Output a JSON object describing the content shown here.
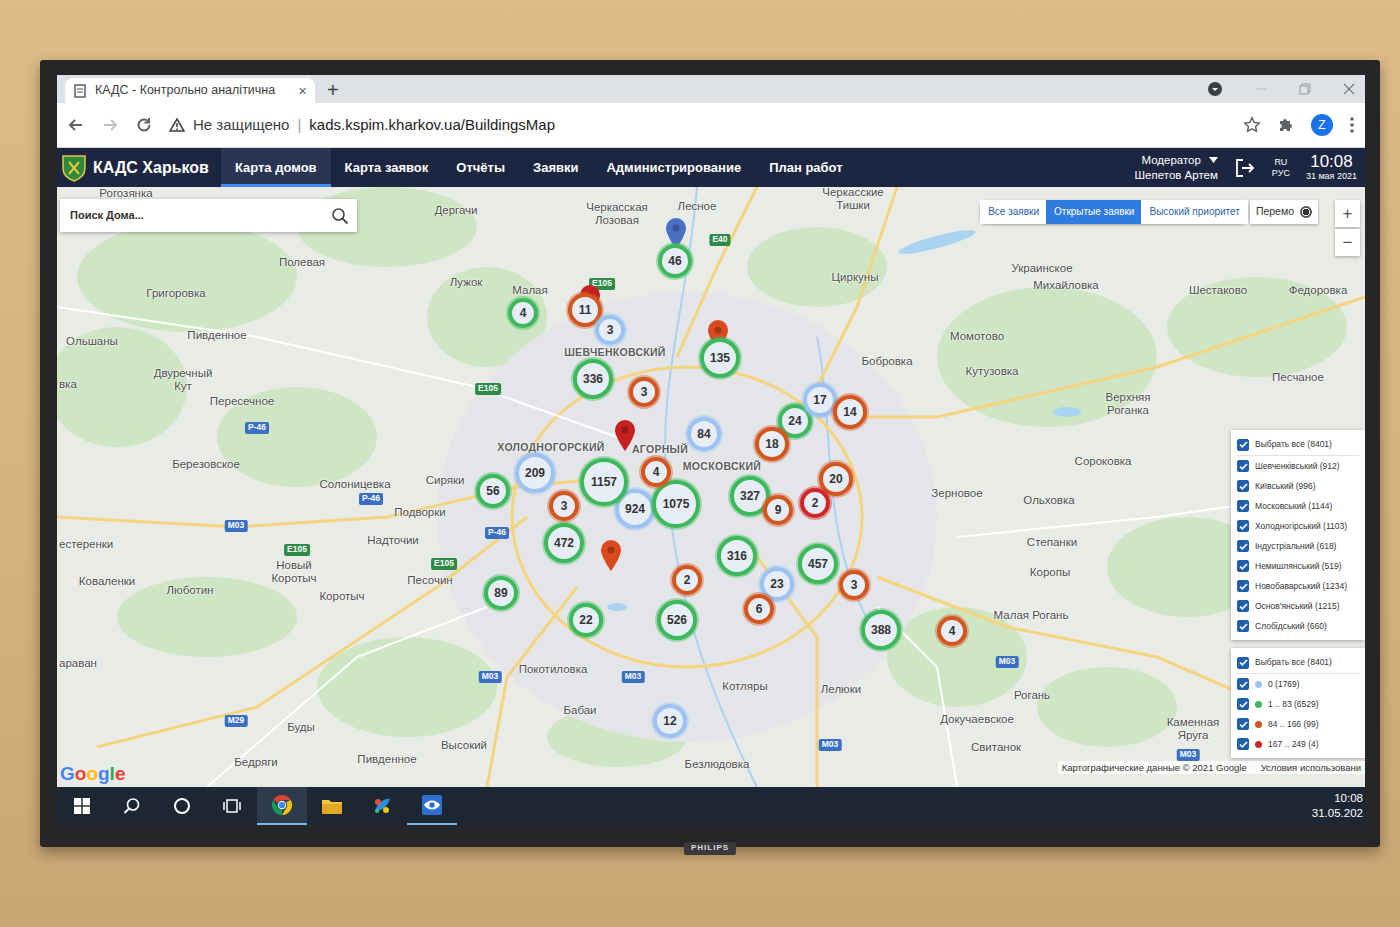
{
  "tv": {
    "brand": "PHILIPS"
  },
  "browser": {
    "tab": {
      "title": "КАДС - Контрольно аналітична",
      "close": "×"
    },
    "new_tab": "+",
    "security": "Не защищено",
    "separator": "|",
    "url": "kads.kspim.kharkov.ua/BuildingsMap",
    "avatar": "Z"
  },
  "app": {
    "title": "КАДС Харьков",
    "nav": [
      {
        "label": "Карта домов",
        "selected": true
      },
      {
        "label": "Карта заявок",
        "selected": false
      },
      {
        "label": "Отчёты",
        "selected": false
      },
      {
        "label": "Заявки",
        "selected": false
      },
      {
        "label": "Администрирование",
        "selected": false
      },
      {
        "label": "План работ",
        "selected": false
      }
    ],
    "user": {
      "role": "Модератор",
      "name": "Шепетов Артем"
    },
    "language": {
      "code": "RU",
      "label": "РУС"
    },
    "clock": {
      "time": "10:08",
      "date": "31 мая 2021"
    }
  },
  "map": {
    "search": {
      "placeholder": "Поиск Дома..."
    },
    "filters": [
      {
        "label": "Все заявки",
        "selected": false
      },
      {
        "label": "Открытые заявки",
        "selected": true
      },
      {
        "label": "Высокий приоритет",
        "selected": false
      }
    ],
    "layer_toggle": {
      "label": "Перемо",
      "checked": true
    },
    "zoom": {
      "in": "+",
      "out": "−"
    },
    "places": [
      {
        "text": "Рогозянка",
        "kind": "town"
      },
      {
        "text": "Дергачи",
        "kind": "town"
      },
      {
        "text": "Черкасская Лозовая",
        "kind": "stacked"
      },
      {
        "text": "Лесное",
        "kind": "town"
      },
      {
        "text": "Черкасские Тишки",
        "kind": "stacked"
      },
      {
        "text": "Полевая",
        "kind": "town"
      },
      {
        "text": "Григоровка",
        "kind": "town"
      },
      {
        "text": "Лужок",
        "kind": "town"
      },
      {
        "text": "Малая",
        "kind": "town"
      },
      {
        "text": "Пивденное",
        "kind": "town"
      },
      {
        "text": "Ольшаны",
        "kind": "town"
      },
      {
        "text": "Двуречный Кут",
        "kind": "stacked"
      },
      {
        "text": "Пересечное",
        "kind": "town"
      },
      {
        "text": "Циркуны",
        "kind": "town"
      },
      {
        "text": "Украинское",
        "kind": "town"
      },
      {
        "text": "Михайловка",
        "kind": "town"
      },
      {
        "text": "Шестаково",
        "kind": "town"
      },
      {
        "text": "Федоровка",
        "kind": "town"
      },
      {
        "text": "Момотово",
        "kind": "town"
      },
      {
        "text": "Бобровка",
        "kind": "town"
      },
      {
        "text": "Кутузовка",
        "kind": "town"
      },
      {
        "text": "Песчаное",
        "kind": "town"
      },
      {
        "text": "Верхняя Роганка",
        "kind": "stacked"
      },
      {
        "text": "Сороковка",
        "kind": "town"
      },
      {
        "text": "Березовское",
        "kind": "town"
      },
      {
        "text": "Солоницевка",
        "kind": "town"
      },
      {
        "text": "Сиряки",
        "kind": "town"
      },
      {
        "text": "Подворки",
        "kind": "town"
      },
      {
        "text": "Надточии",
        "kind": "town"
      },
      {
        "text": "Зерновое",
        "kind": "town"
      },
      {
        "text": "Ольховка",
        "kind": "town"
      },
      {
        "text": "Степанки",
        "kind": "town"
      },
      {
        "text": "Коропы",
        "kind": "town"
      },
      {
        "text": "Малая Рогань",
        "kind": "town"
      },
      {
        "text": "Рогань",
        "kind": "town"
      },
      {
        "text": "Коваленки",
        "kind": "town"
      },
      {
        "text": "Люботин",
        "kind": "town"
      },
      {
        "text": "Новый Коротыч",
        "kind": "stacked"
      },
      {
        "text": "Коротыч",
        "kind": "town"
      },
      {
        "text": "Песочин",
        "kind": "town"
      },
      {
        "text": "Покотиловка",
        "kind": "town"
      },
      {
        "text": "Бабаи",
        "kind": "town"
      },
      {
        "text": "Котляры",
        "kind": "town"
      },
      {
        "text": "Лелюки",
        "kind": "town"
      },
      {
        "text": "Высокий",
        "kind": "town"
      },
      {
        "text": "Буды",
        "kind": "town"
      },
      {
        "text": "Бедряги",
        "kind": "town"
      },
      {
        "text": "Пивденное",
        "kind": "town"
      },
      {
        "text": "Безлюдовка",
        "kind": "town"
      },
      {
        "text": "Докучаевское",
        "kind": "town"
      },
      {
        "text": "Свитанок",
        "kind": "town"
      },
      {
        "text": "Каменная Яруга",
        "kind": "stacked"
      },
      {
        "text": "вка",
        "kind": "edge"
      },
      {
        "text": "естеренки",
        "kind": "edge"
      },
      {
        "text": "араван",
        "kind": "edge"
      },
      {
        "text": "ШЕВЧЕНКОВСКИЙ",
        "kind": "district"
      },
      {
        "text": "ХОЛОДНОГОРСКИЙ",
        "kind": "district"
      },
      {
        "text": "МОСКОВСКИЙ",
        "kind": "district"
      },
      {
        "text": "АГОРНЫЙ",
        "kind": "district"
      }
    ],
    "roads": [
      {
        "label": "E40",
        "color": "#2e8b46"
      },
      {
        "label": "E105",
        "color": "#2e8b46"
      },
      {
        "label": "E105",
        "color": "#2e8b46"
      },
      {
        "label": "P-46",
        "color": "#3a6fc4"
      },
      {
        "label": "P-46",
        "color": "#3a6fc4"
      },
      {
        "label": "P-46",
        "color": "#3a6fc4"
      },
      {
        "label": "M03",
        "color": "#3a6fc4"
      },
      {
        "label": "E105",
        "color": "#2e8b46"
      },
      {
        "label": "E105",
        "color": "#2e8b46"
      },
      {
        "label": "M03",
        "color": "#3a6fc4"
      },
      {
        "label": "M03",
        "color": "#3a6fc4"
      },
      {
        "label": "M29",
        "color": "#3a6fc4"
      },
      {
        "label": "M03",
        "color": "#3a6fc4"
      },
      {
        "label": "M03",
        "color": "#3a6fc4"
      },
      {
        "label": "M03",
        "color": "#3a6fc4"
      }
    ],
    "pins": [
      {
        "color": "#4a70c4"
      },
      {
        "color": "#c8201f"
      },
      {
        "color": "#d9491d"
      },
      {
        "color": "#c8201f"
      },
      {
        "color": "#d9491d"
      }
    ],
    "clusters": [
      {
        "count": "46",
        "color": "#3cb95a"
      },
      {
        "count": "4",
        "color": "#3cb95a"
      },
      {
        "count": "11",
        "color": "#d4561f"
      },
      {
        "count": "3",
        "color": "#9cc2f2"
      },
      {
        "count": "336",
        "color": "#3cb95a"
      },
      {
        "count": "3",
        "color": "#d4561f"
      },
      {
        "count": "135",
        "color": "#3cb95a"
      },
      {
        "count": "84",
        "color": "#9cc2f2"
      },
      {
        "count": "24",
        "color": "#3cb95a"
      },
      {
        "count": "17",
        "color": "#9cc2f2"
      },
      {
        "count": "14",
        "color": "#d4561f"
      },
      {
        "count": "18",
        "color": "#d4561f"
      },
      {
        "count": "209",
        "color": "#9cc2f2"
      },
      {
        "count": "924",
        "color": "#9cc2f2"
      },
      {
        "count": "1157",
        "color": "#3cb95a"
      },
      {
        "count": "1075",
        "color": "#3cb95a"
      },
      {
        "count": "4",
        "color": "#d4561f"
      },
      {
        "count": "56",
        "color": "#3cb95a"
      },
      {
        "count": "3",
        "color": "#d4561f"
      },
      {
        "count": "327",
        "color": "#3cb95a"
      },
      {
        "count": "9",
        "color": "#d4561f"
      },
      {
        "count": "20",
        "color": "#d4561f"
      },
      {
        "count": "2",
        "color": "#d0262a"
      },
      {
        "count": "472",
        "color": "#3cb95a"
      },
      {
        "count": "316",
        "color": "#3cb95a"
      },
      {
        "count": "457",
        "color": "#3cb95a"
      },
      {
        "count": "2",
        "color": "#d4561f"
      },
      {
        "count": "23",
        "color": "#9cc2f2"
      },
      {
        "count": "6",
        "color": "#d4561f"
      },
      {
        "count": "3",
        "color": "#d4561f"
      },
      {
        "count": "89",
        "color": "#3cb95a"
      },
      {
        "count": "22",
        "color": "#3cb95a"
      },
      {
        "count": "526",
        "color": "#3cb95a"
      },
      {
        "count": "388",
        "color": "#3cb95a"
      },
      {
        "count": "4",
        "color": "#d4561f"
      },
      {
        "count": "12",
        "color": "#9cc2f2"
      }
    ],
    "district_filter": {
      "select_all": {
        "label": "Выбрать все (8401)",
        "checked": true
      },
      "items": [
        {
          "label": "Шевченківський (912)",
          "checked": true
        },
        {
          "label": "Київський (996)",
          "checked": true
        },
        {
          "label": "Московський (1144)",
          "checked": true
        },
        {
          "label": "Холодногірський (1103)",
          "checked": true
        },
        {
          "label": "Індустріальний (618)",
          "checked": true
        },
        {
          "label": "Немишлянський (519)",
          "checked": true
        },
        {
          "label": "Новобаварський (1234)",
          "checked": true
        },
        {
          "label": "Основ'янський (1215)",
          "checked": true
        },
        {
          "label": "Слобідський (660)",
          "checked": true
        }
      ]
    },
    "size_filter": {
      "select_all": {
        "label": "Выбрать все (8401)",
        "checked": true
      },
      "items": [
        {
          "label": "0 (1769)",
          "checked": true,
          "color": "#9cc2f2"
        },
        {
          "label": "1 .. 83 (6529)",
          "checked": true,
          "color": "#3cb95a"
        },
        {
          "label": "84 .. 166 (99)",
          "checked": true,
          "color": "#d4561f"
        },
        {
          "label": "167 .. 249 (4)",
          "checked": true,
          "color": "#d0262a"
        }
      ]
    },
    "attribution": {
      "logo": "Google",
      "data": "Картографические данные © 2021 Google",
      "terms": "Условия использовани"
    }
  },
  "taskbar": {
    "time": "10:08",
    "date": "31.05.202"
  }
}
